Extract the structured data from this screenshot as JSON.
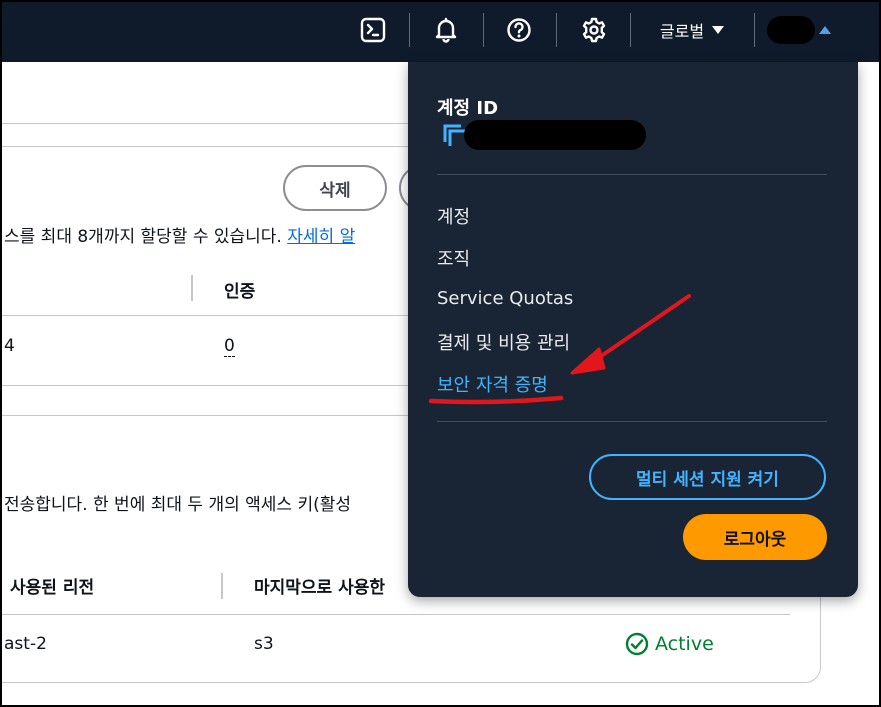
{
  "topnav": {
    "icons": {
      "cloudshell": "cloudshell-icon",
      "notifications": "bell-icon",
      "help": "help-icon",
      "settings": "gear-icon"
    },
    "region_label": "글로벌",
    "accent_color": "#539fe5"
  },
  "background": {
    "delete_button": "삭제",
    "mfa_note": "스를 최대 8개까지 할당할 수 있습니다.",
    "mfa_link": "자세히 알",
    "col_auth": "인증",
    "row_value_left": "4",
    "row_value_auth": "0",
    "access_key_note": "전송합니다. 한 번에 최대 두 개의 액세스 키(활성",
    "col_last_region": "사용된 리전",
    "col_last_used": "마지막으로 사용한",
    "cell_region": "ast-2",
    "cell_service": "s3",
    "status": "Active",
    "status_color": "#00802f"
  },
  "account_menu": {
    "account_id_label": "계정 ID",
    "items": [
      {
        "label": "계정"
      },
      {
        "label": "조직"
      },
      {
        "label": "Service Quotas"
      },
      {
        "label": "결제 및 비용 관리"
      },
      {
        "label": "보안 자격 증명"
      }
    ],
    "multi_session_button": "멀티 세션 지원 켜기",
    "signout_button": "로그아웃",
    "highlight_color": "#42b4ff",
    "primary_color": "#ff9900"
  },
  "annotation": {
    "color": "#e3161b"
  }
}
